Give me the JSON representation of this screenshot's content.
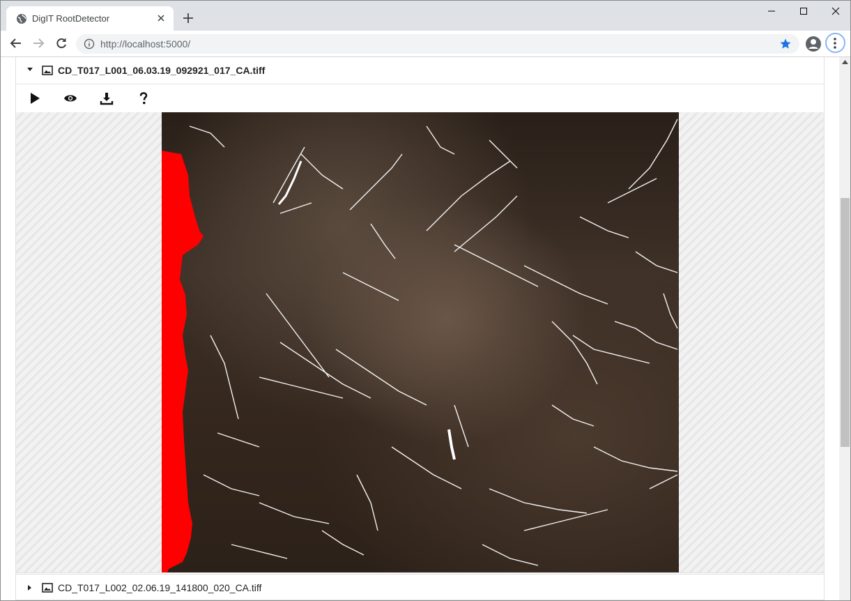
{
  "browser": {
    "tab_title": "DigIT RootDetector",
    "url": "http://localhost:5000/"
  },
  "files": [
    {
      "name": "CD_T017_L001_06.03.19_092921_017_CA.tiff",
      "expanded": true,
      "actions": [
        "play-icon",
        "eye-icon",
        "download-icon",
        "help-icon"
      ]
    },
    {
      "name": "CD_T017_L002_02.06.19_141800_020_CA.tiff",
      "expanded": false
    }
  ],
  "colors": {
    "mask": "#ff0000",
    "roots": "#ffffff",
    "soil": "#3d3027",
    "bookmark_star": "#1a73e8"
  }
}
